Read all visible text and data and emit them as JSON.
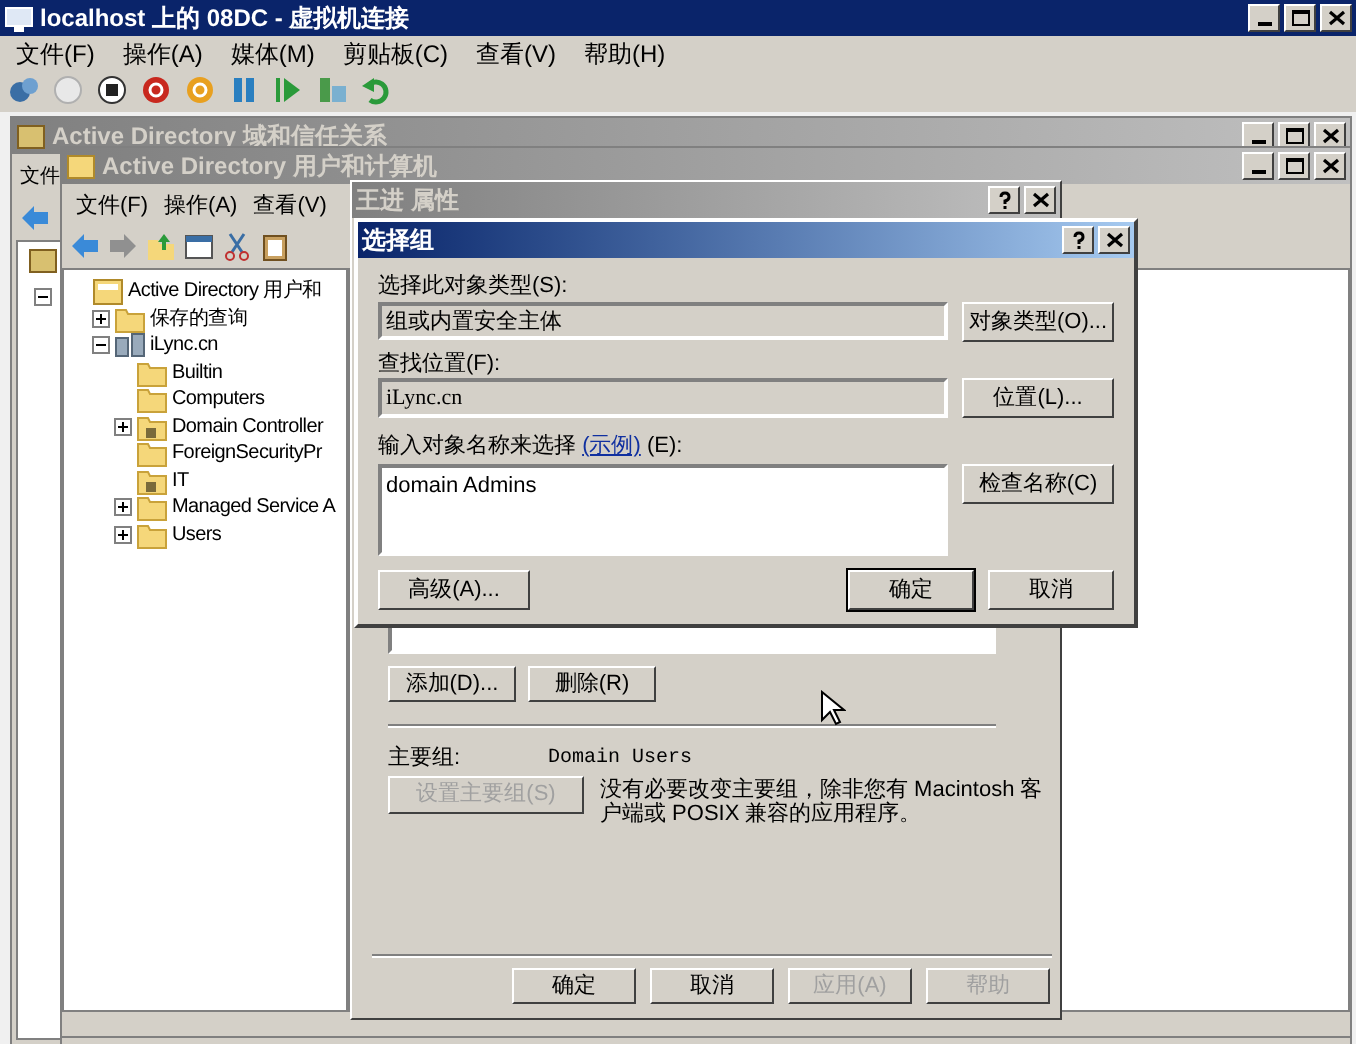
{
  "vm_window": {
    "title": "localhost 上的 08DC - 虚拟机连接",
    "menu": [
      "文件(F)",
      "操作(A)",
      "媒体(M)",
      "剪贴板(C)",
      "查看(V)",
      "帮助(H)"
    ]
  },
  "domains_window": {
    "title": "Active Directory 域和信任关系",
    "menu": [
      "文件"
    ]
  },
  "aduc_window": {
    "title": "Active Directory 用户和计算机",
    "menu": [
      "文件(F)",
      "操作(A)",
      "查看(V)"
    ],
    "tree": [
      {
        "label": "Active Directory 用户和",
        "kind": "root",
        "children": [
          {
            "label": "保存的查询",
            "kind": "folder",
            "expanded": false
          },
          {
            "label": "iLync.cn",
            "kind": "domain",
            "expanded": true,
            "children": [
              {
                "label": "Builtin",
                "kind": "folder"
              },
              {
                "label": "Computers",
                "kind": "folder"
              },
              {
                "label": "Domain Controller",
                "kind": "ou",
                "expanded": false
              },
              {
                "label": "ForeignSecurityPr",
                "kind": "folder"
              },
              {
                "label": "IT",
                "kind": "ou"
              },
              {
                "label": "Managed Service A",
                "kind": "folder",
                "expanded": false
              },
              {
                "label": "Users",
                "kind": "folder",
                "expanded": false
              }
            ]
          }
        ]
      }
    ]
  },
  "properties_dialog": {
    "title": "王进 属性",
    "list_buttons": [
      {
        "label": "添加(D)...",
        "disabled": false
      },
      {
        "label": "删除(R)",
        "disabled": false
      }
    ],
    "primary_group_label": "主要组:",
    "primary_group": "Domain Users",
    "set_primary_button": {
      "label": "设置主要组(S)",
      "disabled": true
    },
    "note": "没有必要改变主要组，除非您有 Macintosh 客户端或 POSIX 兼容的应用程序。",
    "buttons": [
      {
        "label": "确定",
        "disabled": false
      },
      {
        "label": "取消",
        "disabled": false
      },
      {
        "label": "应用(A)",
        "disabled": true
      },
      {
        "label": "帮助",
        "disabled": true
      }
    ]
  },
  "select_dialog": {
    "title": "选择组",
    "type_label": "选择此对象类型(S):",
    "type_value": "组或内置安全主体",
    "type_button": "对象类型(O)...",
    "location_label": "查找位置(F):",
    "location_value": "iLync.cn",
    "location_button": "位置(L)...",
    "names_label": "输入对象名称来选择 ",
    "names_link": "(示例)",
    "names_label_end": " (E):",
    "names_value": "domain Admins",
    "check_button": "检查名称(C)",
    "advanced_button": "高级(A)...",
    "ok_button": "确定",
    "cancel_button": "取消"
  }
}
